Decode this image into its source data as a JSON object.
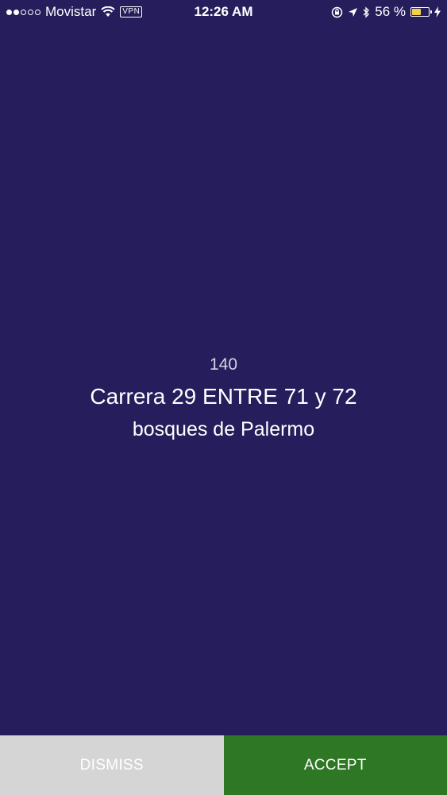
{
  "status_bar": {
    "signal_filled": 2,
    "signal_total": 5,
    "carrier": "Movistar",
    "wifi_icon": "wifi-icon",
    "vpn_label": "VPN",
    "time": "12:26 AM",
    "battery_percent": "56 %",
    "battery_level": 0.56,
    "battery_color": "#f3cf4a"
  },
  "request": {
    "number": "140",
    "address": "Carrera 29 ENTRE 71 y 72",
    "neighborhood": "bosques de Palermo"
  },
  "actions": {
    "dismiss_label": "DISMISS",
    "accept_label": "ACCEPT",
    "dismiss_color": "#d5d5d5",
    "accept_color": "#2e7724"
  },
  "colors": {
    "background": "#261e5c"
  }
}
